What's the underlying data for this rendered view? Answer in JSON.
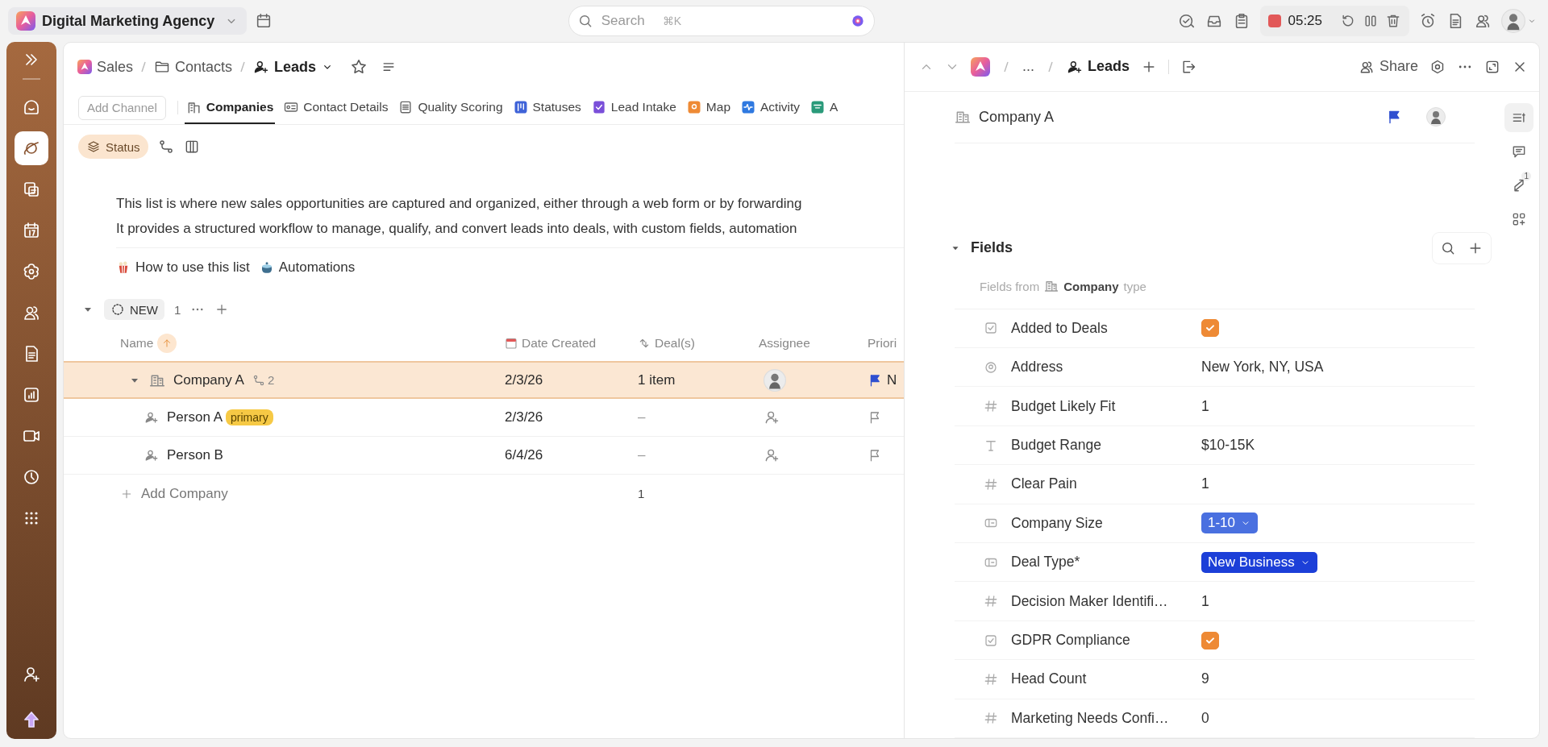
{
  "top_bar": {
    "workspace": "Digital Marketing Agency",
    "search_placeholder": "Search",
    "search_shortcut": "⌘K",
    "timer": "05:25"
  },
  "sidebar": {
    "items": [
      {
        "selected": false
      },
      {
        "selected": true
      },
      {
        "selected": false
      },
      {
        "selected": false
      },
      {
        "selected": false
      },
      {
        "selected": false
      },
      {
        "selected": false
      },
      {
        "selected": false
      },
      {
        "selected": false
      },
      {
        "selected": false
      },
      {
        "selected": false
      }
    ]
  },
  "breadcrumb": [
    {
      "label": "Sales",
      "kind": "space"
    },
    {
      "label": "Contacts",
      "kind": "folder"
    },
    {
      "label": "Leads",
      "kind": "list"
    }
  ],
  "add_channel": "Add Channel",
  "tabs": [
    {
      "label": "Companies",
      "selected": true
    },
    {
      "label": "Contact Details",
      "selected": false
    },
    {
      "label": "Quality Scoring",
      "selected": false
    },
    {
      "label": "Statuses",
      "selected": false
    },
    {
      "label": "Lead Intake",
      "selected": false
    },
    {
      "label": "Map",
      "selected": false
    },
    {
      "label": "Activity",
      "selected": false
    },
    {
      "label": "A",
      "selected": false
    }
  ],
  "filter": {
    "label": "Status"
  },
  "description": [
    "This list is where new sales opportunities are captured and organized, either through a web form or by forwarding",
    "It provides a structured workflow to manage, qualify, and convert leads into deals, with custom fields, automation"
  ],
  "links": [
    "How to use this list",
    "Automations"
  ],
  "group": {
    "label": "NEW",
    "count": "1",
    "expanded": true
  },
  "table": {
    "columns": [
      "Name",
      "Date Created",
      "Deal(s)",
      "Assignee",
      "Priori"
    ],
    "rows": [
      {
        "kind": "company",
        "name": "Company A",
        "subtasks": "2",
        "date": "2/3/26",
        "deals": "1 item",
        "assigned": true,
        "priority": "N",
        "selected": true,
        "expanded": true,
        "children": [
          {
            "kind": "person",
            "name": "Person A",
            "tag": "primary",
            "date": "2/3/26",
            "deals": "–",
            "assigned": false,
            "selected": false
          },
          {
            "kind": "person",
            "name": "Person B",
            "date": "6/4/26",
            "deals": "–",
            "assigned": false,
            "selected": false
          }
        ]
      }
    ],
    "add_label": "Add Company",
    "add_count": "1"
  },
  "detail": {
    "crumb": "...",
    "title": "Leads",
    "share": "Share",
    "record": "Company A",
    "section": {
      "title": "Fields",
      "expanded": true
    },
    "source": {
      "prefix": "Fields from",
      "type": "Company",
      "suffix": "type"
    },
    "fields": [
      {
        "kind": "checkbox",
        "label": "Added to Deals",
        "checked": true
      },
      {
        "kind": "location",
        "label": "Address",
        "value": "New York, NY, USA"
      },
      {
        "kind": "number",
        "label": "Budget Likely Fit",
        "value": "1"
      },
      {
        "kind": "text",
        "label": "Budget Range",
        "value": "$10-15K"
      },
      {
        "kind": "number",
        "label": "Clear Pain",
        "value": "1"
      },
      {
        "kind": "dropdown",
        "label": "Company Size",
        "value": "1-10",
        "color": "#4a70e0"
      },
      {
        "kind": "dropdown",
        "label": "Deal Type*",
        "value": "New Business",
        "color": "#1c3fd8"
      },
      {
        "kind": "number",
        "label": "Decision Maker Identifi…",
        "value": "1"
      },
      {
        "kind": "checkbox",
        "label": "GDPR Compliance",
        "checked": true
      },
      {
        "kind": "number",
        "label": "Head Count",
        "value": "9"
      },
      {
        "kind": "number",
        "label": "Marketing Needs Confi…",
        "value": "0"
      }
    ],
    "rail": [
      {
        "selected": true
      },
      {
        "selected": false
      },
      {
        "selected": false,
        "badge": "1"
      },
      {
        "selected": false
      }
    ]
  }
}
